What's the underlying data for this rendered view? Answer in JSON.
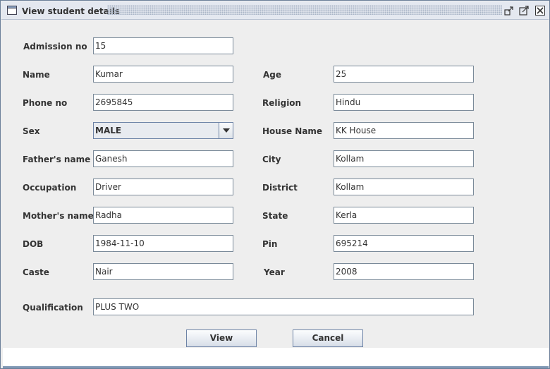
{
  "window": {
    "title": "View student details"
  },
  "form": {
    "left": [
      {
        "label": "Admission no",
        "value": "15"
      },
      {
        "label": "Name",
        "value": "Kumar"
      },
      {
        "label": "Phone no",
        "value": "2695845"
      },
      {
        "label": "Sex",
        "value": "MALE"
      },
      {
        "label": "Father's name",
        "value": "Ganesh"
      },
      {
        "label": "Occupation",
        "value": "Driver"
      },
      {
        "label": "Mother's name",
        "value": "Radha"
      },
      {
        "label": "DOB",
        "value": "1984-11-10"
      },
      {
        "label": "Caste",
        "value": "Nair"
      }
    ],
    "right": [
      {
        "label": "Age",
        "value": "25"
      },
      {
        "label": "Religion",
        "value": "Hindu"
      },
      {
        "label": "House Name",
        "value": "KK House"
      },
      {
        "label": "City",
        "value": "Kollam"
      },
      {
        "label": "District",
        "value": "Kollam"
      },
      {
        "label": "State",
        "value": "Kerla"
      },
      {
        "label": "Pin",
        "value": "695214"
      },
      {
        "label": "Year",
        "value": "2008"
      }
    ],
    "qualification": {
      "label": "Qualification",
      "value": "PLUS TWO"
    }
  },
  "buttons": {
    "view": "View",
    "cancel": "Cancel"
  }
}
